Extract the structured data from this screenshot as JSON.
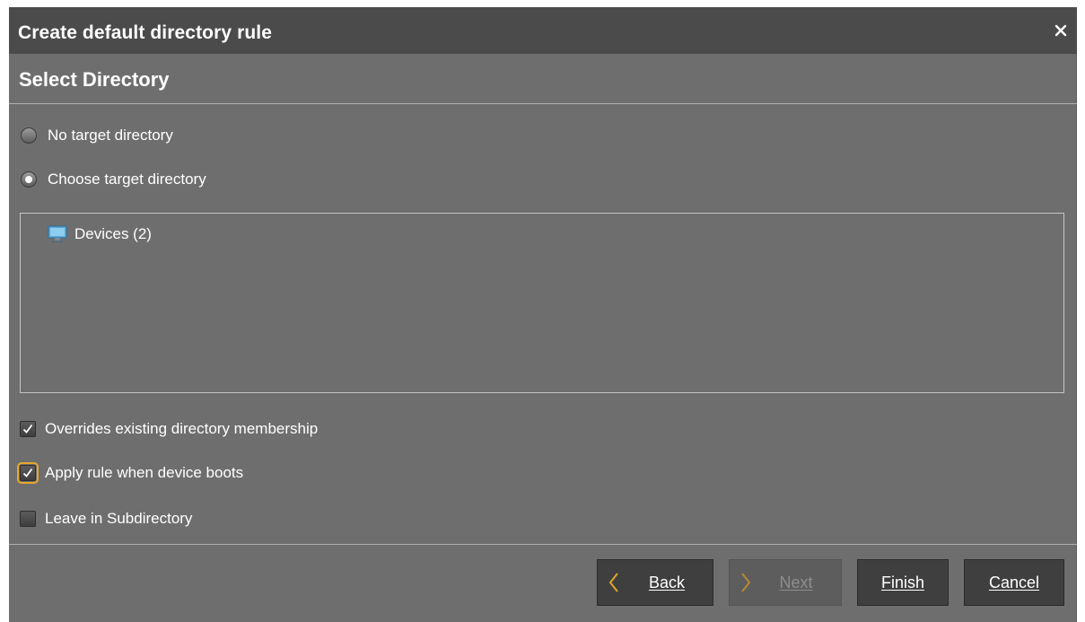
{
  "dialog": {
    "title": "Create default directory rule",
    "close_icon": "close-icon",
    "section_title": "Select Directory"
  },
  "target": {
    "options": [
      {
        "label": "No target directory",
        "selected": false
      },
      {
        "label": "Choose target directory",
        "selected": true
      }
    ]
  },
  "tree": {
    "items": [
      {
        "label": "Devices (2)",
        "icon": "monitor-icon"
      }
    ]
  },
  "checks": [
    {
      "label": "Overrides existing directory membership",
      "checked": true
    },
    {
      "label": "Apply rule when device boots",
      "checked": true,
      "focused": true
    },
    {
      "label": "Leave in Subdirectory",
      "checked": false
    }
  ],
  "buttons": {
    "back": "Back",
    "next": "Next",
    "finish": "Finish",
    "cancel": "Cancel"
  },
  "colors": {
    "panel": "#6e6e6e",
    "titlebar": "#4b4b4b",
    "button": "#3f3f3f",
    "arrow_accent": "#e0a52a",
    "focus_outline": "#e7a72a"
  }
}
